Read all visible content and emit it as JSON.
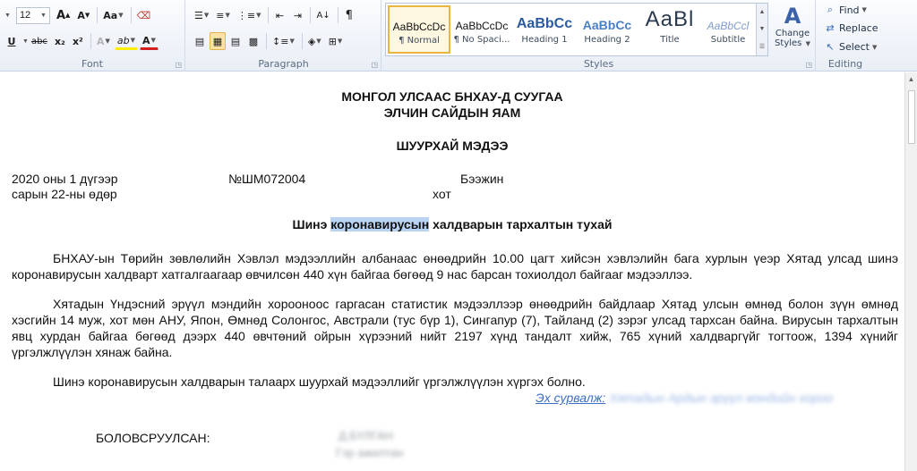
{
  "ribbon": {
    "font": {
      "label": "Font",
      "size_value": "12",
      "grow_label": "A",
      "shrink_label": "A",
      "case_label": "Aa",
      "underline_label": "U",
      "strike_label": "abc",
      "sub_label": "x₂",
      "sup_label": "x²",
      "effects_label": "A",
      "highlight_label": "ab",
      "color_label": "A"
    },
    "paragraph": {
      "label": "Paragraph",
      "pilcrow": "¶"
    },
    "styles": {
      "label": "Styles",
      "items": [
        {
          "preview": "AaBbCcDc",
          "name": "¶ Normal"
        },
        {
          "preview": "AaBbCcDc",
          "name": "¶ No Spaci..."
        },
        {
          "preview": "AaBbCc",
          "name": "Heading 1"
        },
        {
          "preview": "AaBbCc",
          "name": "Heading 2"
        },
        {
          "preview": "AaBl",
          "name": "Title"
        },
        {
          "preview": "AaBbCcl",
          "name": "Subtitle"
        }
      ],
      "change_styles_line1": "Change",
      "change_styles_line2": "Styles"
    },
    "editing": {
      "label": "Editing",
      "find": "Find",
      "replace": "Replace",
      "select": "Select"
    }
  },
  "document": {
    "title_line1": "МОНГОЛ УЛСААС БНХАУ-Д СУУГАА",
    "title_line2": "ЭЛЧИН САЙДЫН ЯАМ",
    "heading": "ШУУРХАЙ МЭДЭЭ",
    "date_line1": "2020 оны 1 дүгээр",
    "date_line2": "сарын 22-ны өдөр",
    "number": "№ШМ072004",
    "city_line1": "Бээжин",
    "city_line2": "хот",
    "subject_pre": "Шинэ ",
    "subject_hl": "коронавирусын",
    "subject_post": " халдварын тархалтын тухай",
    "para1": "БНХАУ-ын Төрийн зөвлөлийн Хэвлэл мэдээллийн албанаас өнөөдрийн 10.00 цагт хийсэн хэвлэлийн бага хурлын үеэр Хятад улсад шинэ коронавирусын халдварт хатгалгаагаар өвчилсөн 440 хүн байгаа бөгөөд 9 нас барсан тохиолдол байгааг мэдээллээ.",
    "para2": "Хятадын Үндэсний эрүүл мэндийн хорооноос гаргасан статистик мэдээллээр өнөөдрийн байдлаар Хятад улсын өмнөд болон зүүн өмнөд хэсгийн 14 муж, хот мөн АНУ, Япон, Өмнөд Солонгос, Австрали (тус бүр 1), Сингапур (7), Тайланд (2) зэрэг улсад тархсан байна. Вирусын тархалтын явц хурдан байгаа бөгөөд дээрх 440 өвчтөний ойрын хүрээний нийт 2197 хүнд тандалт хийж, 765 хүний халдваргүйг тогтоож, 1394 хүнийг үргэлжлүүлэн хянаж байна.",
    "para3": "Шинэ коронавирусын халдварын талаарх шуурхай мэдээллийг үргэлжлүүлэн хүргэх болно.",
    "source_label": "Эх сурвалж:",
    "source_blurred": "Хятадын Ардын эрүүл мэндийн хороо",
    "prepared_label": "БОЛОВСРУУЛСАН:",
    "prepared_name": "Д.БҮЛГАН",
    "prepared_title": "Гэр ажилтан"
  }
}
